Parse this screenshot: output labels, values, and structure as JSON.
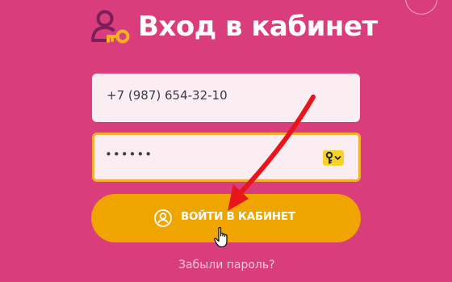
{
  "header": {
    "title": "Вход в кабинет",
    "icon": "user-key-icon"
  },
  "form": {
    "phone_value": "+7 (987) 654-32-10",
    "password_mask": "••••••",
    "key_button_icon": "key-dropdown-icon",
    "submit_label": "ВОЙТИ В КАБИНЕТ",
    "submit_icon": "user-circle-icon",
    "forgot_link": "Забыли пароль?"
  },
  "colors": {
    "background": "#d93d7c",
    "field_background": "#fbeef3",
    "focus_border": "#f2b032",
    "button": "#f0a400",
    "key_button": "#f6d32a",
    "annotation_arrow": "#e8151b"
  },
  "overlay": {
    "arrow_icon": "red-arrow-icon",
    "cursor_icon": "hand-pointer-icon",
    "close_icon": "close-icon"
  }
}
